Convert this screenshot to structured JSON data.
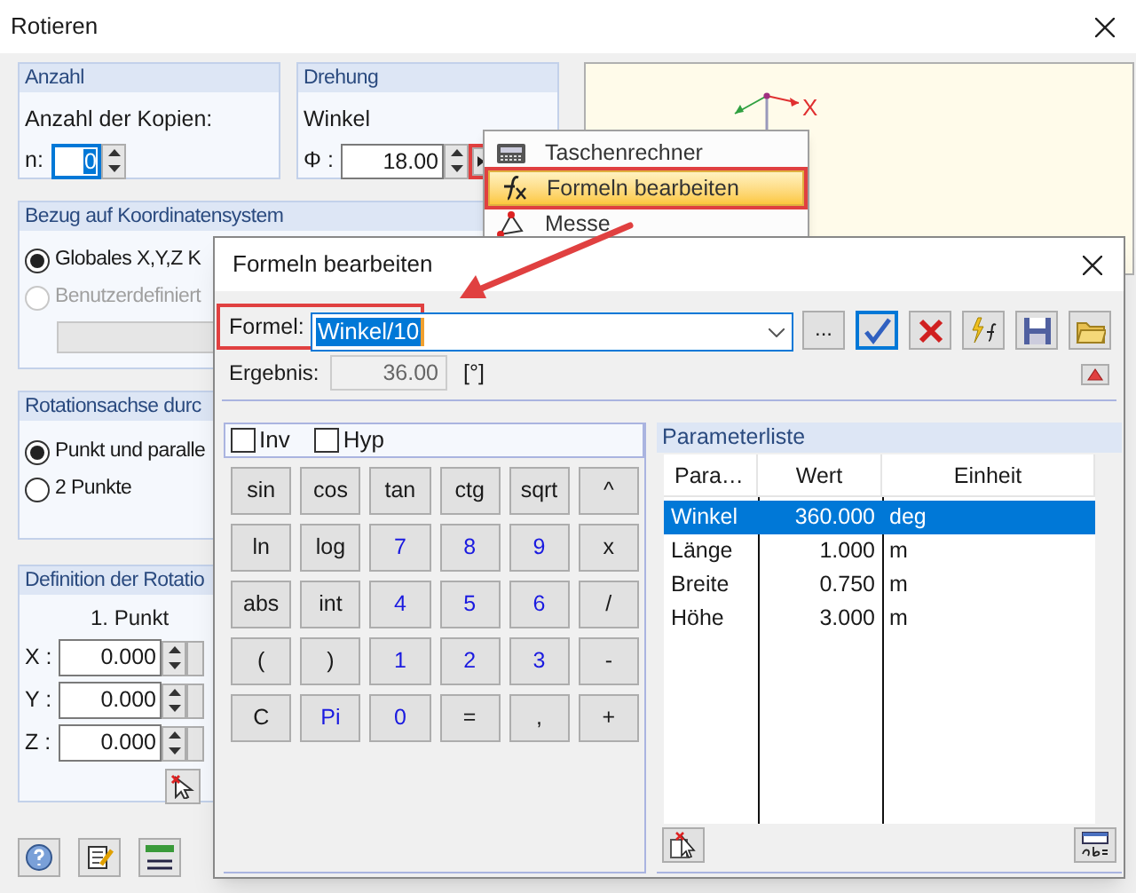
{
  "window": {
    "title": "Rotieren"
  },
  "anzahl": {
    "title": "Anzahl",
    "label": "Anzahl der Kopien:",
    "field_label": "n:",
    "value": "0"
  },
  "drehung": {
    "title": "Drehung",
    "label": "Winkel",
    "field_label": "Φ :",
    "value": "18.00"
  },
  "preview": {
    "axis_label": "X"
  },
  "bezug": {
    "title": "Bezug auf Koordinatensystem",
    "options": [
      {
        "label": "Globales X,Y,Z K",
        "selected": true,
        "disabled": false
      },
      {
        "label": "Benutzerdefiniert",
        "selected": false,
        "disabled": true
      }
    ]
  },
  "rotationsachse": {
    "title": "Rotationsachse durc",
    "options": [
      {
        "label": "Punkt und paralle",
        "selected": true
      },
      {
        "label": "2 Punkte",
        "selected": false
      }
    ]
  },
  "definition": {
    "title": "Definition der Rotatio",
    "point_title": "1. Punkt",
    "coords": [
      {
        "label": "X :",
        "value": "0.000"
      },
      {
        "label": "Y :",
        "value": "0.000"
      },
      {
        "label": "Z :",
        "value": "0.000"
      }
    ]
  },
  "context_menu": {
    "items": [
      {
        "label": "Taschenrechner",
        "selected": false
      },
      {
        "label": "Formeln bearbeiten",
        "selected": true
      },
      {
        "label": "Messe",
        "selected": false
      }
    ]
  },
  "formula_dialog": {
    "title": "Formeln bearbeiten",
    "formula_label": "Formel:",
    "formula": "Winkel/10",
    "more_button": "...",
    "result_label": "Ergebnis:",
    "result": "36.00",
    "result_unit": "[°]",
    "checkboxes": [
      {
        "label": "Inv",
        "checked": false
      },
      {
        "label": "Hyp",
        "checked": false
      }
    ],
    "keypad": [
      {
        "label": "sin",
        "kind": "operator"
      },
      {
        "label": "cos",
        "kind": "operator"
      },
      {
        "label": "tan",
        "kind": "operator"
      },
      {
        "label": "ctg",
        "kind": "operator"
      },
      {
        "label": "sqrt",
        "kind": "operator"
      },
      {
        "label": "^",
        "kind": "operator"
      },
      {
        "label": "ln",
        "kind": "operator"
      },
      {
        "label": "log",
        "kind": "operator"
      },
      {
        "label": "7",
        "kind": "number"
      },
      {
        "label": "8",
        "kind": "number"
      },
      {
        "label": "9",
        "kind": "number"
      },
      {
        "label": "x",
        "kind": "operator"
      },
      {
        "label": "abs",
        "kind": "operator"
      },
      {
        "label": "int",
        "kind": "operator"
      },
      {
        "label": "4",
        "kind": "number"
      },
      {
        "label": "5",
        "kind": "number"
      },
      {
        "label": "6",
        "kind": "number"
      },
      {
        "label": "/",
        "kind": "operator"
      },
      {
        "label": "(",
        "kind": "operator"
      },
      {
        "label": ")",
        "kind": "operator"
      },
      {
        "label": "1",
        "kind": "number"
      },
      {
        "label": "2",
        "kind": "number"
      },
      {
        "label": "3",
        "kind": "number"
      },
      {
        "label": "-",
        "kind": "operator"
      },
      {
        "label": "C",
        "kind": "operator"
      },
      {
        "label": "Pi",
        "kind": "number"
      },
      {
        "label": "0",
        "kind": "number"
      },
      {
        "label": "=",
        "kind": "operator"
      },
      {
        "label": ",",
        "kind": "operator"
      },
      {
        "label": "+",
        "kind": "operator"
      }
    ],
    "parameters": {
      "title": "Parameterliste",
      "columns": [
        "Para…",
        "Wert",
        "Einheit"
      ],
      "rows": [
        {
          "name": "Winkel",
          "value": "360.000",
          "unit": "deg",
          "selected": true
        },
        {
          "name": "Länge",
          "value": "1.000",
          "unit": "m",
          "selected": false
        },
        {
          "name": "Breite",
          "value": "0.750",
          "unit": "m",
          "selected": false
        },
        {
          "name": "Höhe",
          "value": "3.000",
          "unit": "m",
          "selected": false
        }
      ]
    }
  }
}
